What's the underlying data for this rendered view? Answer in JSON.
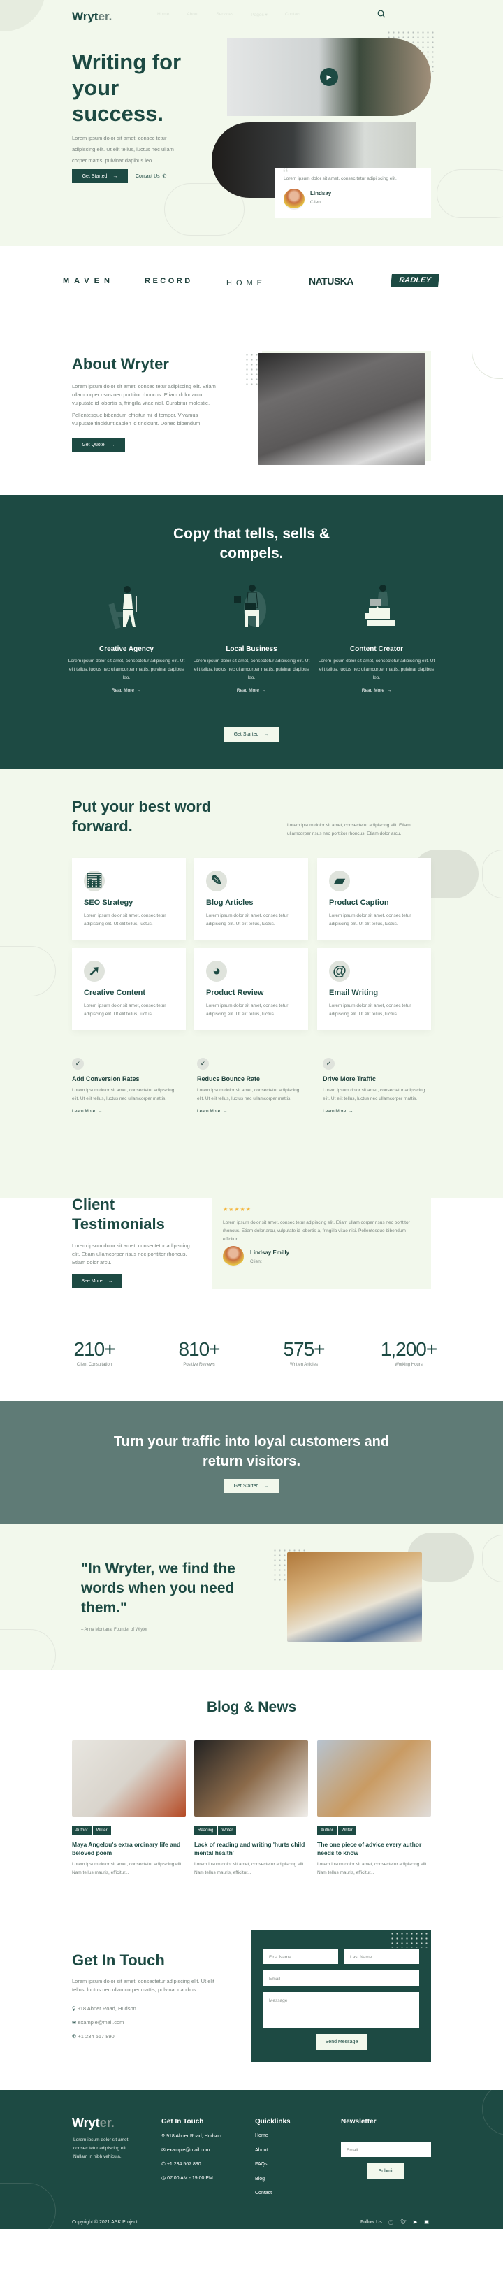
{
  "nav": {
    "logo": "Wryt",
    "logo_accent": "er.",
    "items": [
      "Home",
      "About",
      "Services",
      "Pages",
      "Contact"
    ],
    "search_icon": "search-icon"
  },
  "hero": {
    "title_lines": [
      "Writing for",
      "your",
      "success."
    ],
    "text": "Lorem ipsum dolor sit amet, consec tetur adipiscing elit. Ut elit tellus, luctus nec ullam corper mattis, pulvinar dapibus leo.",
    "primary": "Get Started",
    "secondary": "Contact Us",
    "quote": "Lorem ipsum dolor sit amet, consec tetur adipi scing elit.",
    "client_name": "Lindsay",
    "client_role": "Client"
  },
  "logos": [
    "MAVEN",
    "RECORD",
    "HOME",
    "NATUSKA",
    "RADLEY"
  ],
  "about": {
    "title": "About Wryter",
    "p1": "Lorem ipsum dolor sit amet, consec tetur adipiscing elit. Etiam ullamcorper risus nec porttitor rhoncus. Etiam dolor arcu, vulputate id lobortis a, fringilla vitae nisl. Curabitur molestie.",
    "p2": "Pellentesque bibendum efficitur mi id tempor. Vivamus vulputate tincidunt sapien id tincidunt. Donec bibendum.",
    "button": "Get Quote"
  },
  "copy": {
    "title_lines": [
      "Copy that tells, sells &",
      "compels."
    ],
    "items": [
      {
        "title": "Creative Agency",
        "text": "Lorem ipsum dolor sit amet, consectetur adipiscing elit. Ut elit tellus, luctus nec ullamcorper mattis, pulvinar dapibus leo.",
        "link": "Read More"
      },
      {
        "title": "Local Business",
        "text": "Lorem ipsum dolor sit amet, consectetur adipiscing elit. Ut elit tellus, luctus nec ullamcorper mattis, pulvinar dapibus leo.",
        "link": "Read More"
      },
      {
        "title": "Content Creator",
        "text": "Lorem ipsum dolor sit amet, consectetur adipiscing elit. Ut elit tellus, luctus nec ullamcorper mattis, pulvinar dapibus leo.",
        "link": "Read More"
      }
    ],
    "button": "Get Started"
  },
  "services": {
    "title_lines": [
      "Put your best word",
      "forward."
    ],
    "intro": "Lorem ipsum dolor sit amet, consectetur adipiscing elit. Etiam ullamcorper risus nec porttitor rhoncus. Etiam dolor arcu.",
    "cards": [
      {
        "title": "SEO Strategy",
        "icon": "chart-icon",
        "text": "Lorem ipsum dolor sit amet, consec tetur adipiscing elit. Ut elit tellus, luctus."
      },
      {
        "title": "Blog Articles",
        "icon": "pencil-icon",
        "text": "Lorem ipsum dolor sit amet, consec tetur adipiscing elit. Ut elit tellus, luctus."
      },
      {
        "title": "Product Caption",
        "icon": "folder-icon",
        "text": "Lorem ipsum dolor sit amet, consec tetur adipiscing elit. Ut elit tellus, luctus."
      },
      {
        "title": "Creative Content",
        "icon": "cursor-click-icon",
        "text": "Lorem ipsum dolor sit amet, consec tetur adipiscing elit. Ut elit tellus, luctus."
      },
      {
        "title": "Product Review",
        "icon": "pie-chart-icon",
        "text": "Lorem ipsum dolor sit amet, consec tetur adipiscing elit. Ut elit tellus, luctus."
      },
      {
        "title": "Email Writing",
        "icon": "at-icon",
        "text": "Lorem ipsum dolor sit amet, consec tetur adipiscing elit. Ut elit tellus, luctus."
      }
    ],
    "features": [
      {
        "title": "Add Conversion Rates",
        "text": "Lorem ipsum dolor sit amet, consectetur adipiscing elit. Ut elit tellus, luctus nec ullamcorper mattis.",
        "link": "Learn More"
      },
      {
        "title": "Reduce Bounce Rate",
        "text": "Lorem ipsum dolor sit amet, consectetur adipiscing elit. Ut elit tellus, luctus nec ullamcorper mattis.",
        "link": "Learn More"
      },
      {
        "title": "Drive More Traffic",
        "text": "Lorem ipsum dolor sit amet, consectetur adipiscing elit. Ut elit tellus, luctus nec ullamcorper mattis.",
        "link": "Learn More"
      }
    ]
  },
  "testimonials": {
    "title_lines": [
      "Client",
      "Testimonials"
    ],
    "text": "Lorem ipsum dolor sit amet, consectetur adipiscing elit. Etiam ullamcorper risus nec porttitor rhoncus. Etiam dolor arcu.",
    "button": "See More",
    "rating": 5,
    "quote": "Lorem ipsum dolor sit amet, consec tetur adipiscing elit. Etiam ullam corper risus nec porttitor rhoncus. Etiam dolor arcu, vulputate id lobortis a, fringilla vitae nisi. Pellentesque bibendum efficitur.",
    "name": "Lindsay Emilly",
    "role": "Client",
    "star_color": "#f4b63f"
  },
  "stats": [
    {
      "value": "210+",
      "label": "Client Consultation"
    },
    {
      "value": "810+",
      "label": "Positive Reviews"
    },
    {
      "value": "575+",
      "label": "Written Articles"
    },
    {
      "value": "1,200+",
      "label": "Working Hours"
    }
  ],
  "cta": {
    "title_lines": [
      "Turn your traffic into loyal customers and",
      "return visitors."
    ],
    "button": "Get Started"
  },
  "quote": {
    "lines": [
      "\"In Wryter, we find the",
      "words when you need",
      "them.\""
    ],
    "author": "– Anna Montana, Founder of Wryter"
  },
  "blog": {
    "title": "Blog & News",
    "posts": [
      {
        "tags": [
          "Author",
          "Writer"
        ],
        "title": "Maya Angelou's extra ordinary life and beloved poem",
        "text": "Lorem ipsum dolor sit amet, consectetur adipiscing elit. Nam tellus mauris, efficitur..."
      },
      {
        "tags": [
          "Reading",
          "Writer"
        ],
        "title": "Lack of reading and writing 'hurts child mental health'",
        "text": "Lorem ipsum dolor sit amet, consectetur adipiscing elit. Nam tellus mauris, efficitur..."
      },
      {
        "tags": [
          "Author",
          "Writer"
        ],
        "title": "The one piece of advice every author needs to know",
        "text": "Lorem ipsum dolor sit amet, consectetur adipiscing elit. Nam tellus mauris, efficitur..."
      }
    ]
  },
  "contact": {
    "title": "Get In Touch",
    "text": "Lorem ipsum dolor sit amet, consectetur adipiscing elit. Ut elit tellus, luctus nec ullamcorper mattis, pulvinar dapibus.",
    "address": "918 Abner Road, Hudson",
    "email": "example@mail.com",
    "phone": "+1 234 567 890",
    "form": {
      "first": "First Name",
      "last": "Last Name",
      "email": "Email",
      "message": "Message",
      "submit": "Send Message"
    }
  },
  "footer": {
    "logo": "Wryt",
    "logo_accent": "er.",
    "about": "Lorem ipsum dolor sit amet, consec tetur adipiscing elit. Nullam in nibh vehicula.",
    "contact_title": "Get In Touch",
    "address": "918 Abner Road, Hudson",
    "email": "example@mail.com",
    "phone": "+1 234 567 890",
    "hours": "07.00 AM - 19.00 PM",
    "links_title": "Quicklinks",
    "links": [
      "Home",
      "About",
      "FAQs",
      "Blog",
      "Contact"
    ],
    "newsletter_title": "Newsletter",
    "email_placeholder": "Email",
    "submit": "Submit",
    "copyright": "Copyright © 2021 ASK Project",
    "follow": "Follow Us",
    "social": [
      "facebook-icon",
      "twitter-icon",
      "youtube-icon",
      "linkedin-icon"
    ]
  },
  "colors": {
    "primary": "#1d4a43",
    "light_bg": "#f2f8ec",
    "cta_bg": "#5f7b76"
  }
}
